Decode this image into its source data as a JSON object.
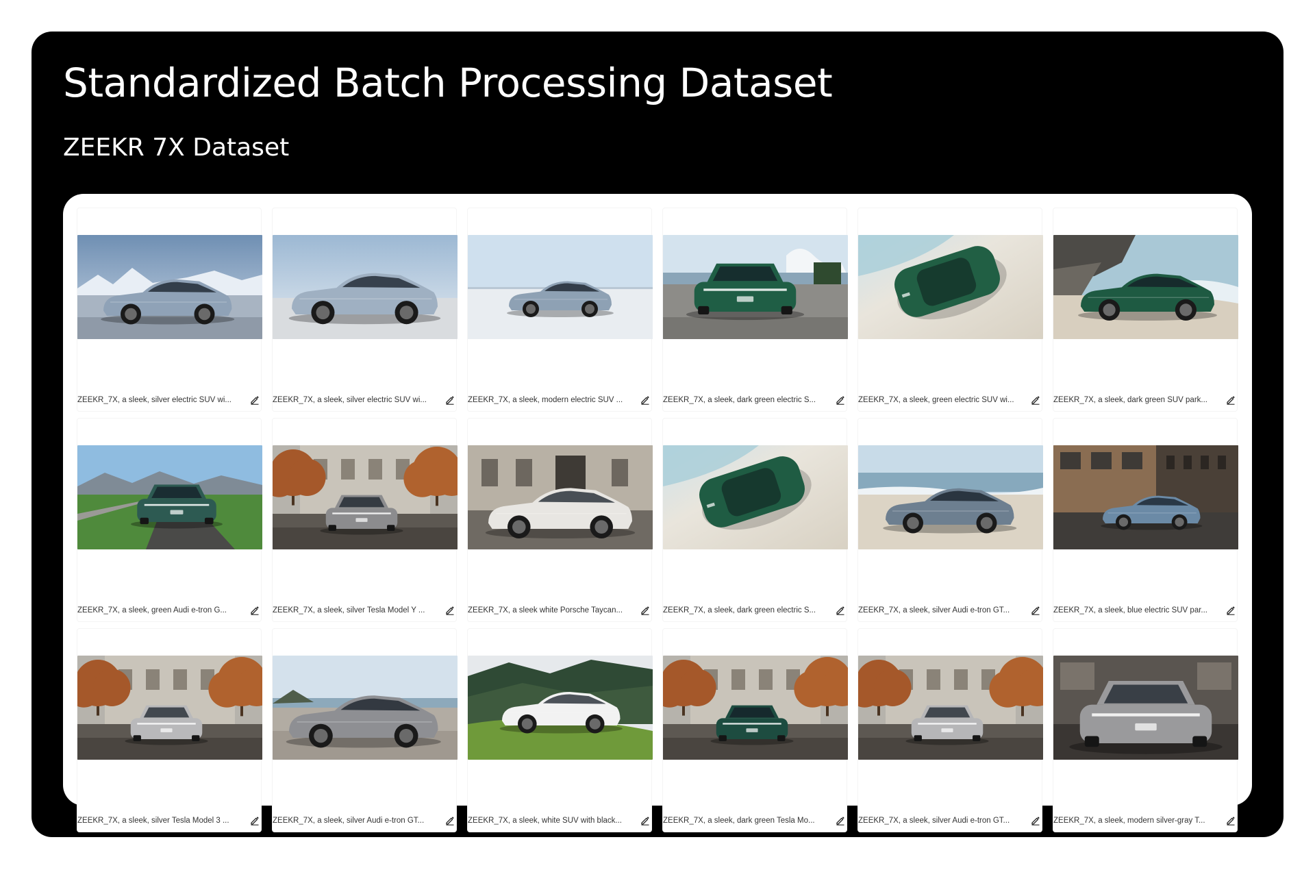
{
  "header": {
    "title": "Standardized Batch Processing Dataset",
    "subtitle": "ZEEKR 7X Dataset"
  },
  "items": [
    {
      "caption": "ZEEKR_7X, a sleek, silver electric SUV wi...",
      "scene": "snow-mountain",
      "car_color": "#8fa2b7"
    },
    {
      "caption": "ZEEKR_7X, a sleek, silver electric SUV wi...",
      "scene": "studio-sky",
      "car_color": "#9fb0c2"
    },
    {
      "caption": "ZEEKR_7X, a sleek, modern electric SUV ...",
      "scene": "salt-flat",
      "car_color": "#8ea1b4"
    },
    {
      "caption": "ZEEKR_7X, a sleek, dark green electric S...",
      "scene": "coast-road",
      "car_color": "#1f5e45"
    },
    {
      "caption": "ZEEKR_7X, a sleek, green electric SUV wi...",
      "scene": "beach-top",
      "car_color": "#215f44"
    },
    {
      "caption": "ZEEKR_7X, a sleek, dark green SUV park...",
      "scene": "rocky-beach",
      "car_color": "#1e5a42"
    },
    {
      "caption": "ZEEKR_7X, a sleek, green Audi e-tron G...",
      "scene": "green-road",
      "car_color": "#2d5a52"
    },
    {
      "caption": "ZEEKR_7X, a sleek, silver Tesla Model Y ...",
      "scene": "autumn-street",
      "car_color": "#8c8c8e"
    },
    {
      "caption": "ZEEKR_7X, a sleek white Porsche Taycan...",
      "scene": "stone-building",
      "car_color": "#e8e6e2"
    },
    {
      "caption": "ZEEKR_7X, a sleek, dark green electric S...",
      "scene": "beach-top",
      "car_color": "#1f5c43"
    },
    {
      "caption": "ZEEKR_7X, a sleek, silver Audi e-tron GT...",
      "scene": "beach-side",
      "car_color": "#6d7f90"
    },
    {
      "caption": "ZEEKR_7X, a sleek, blue electric SUV par...",
      "scene": "city-building",
      "car_color": "#6b8aa6"
    },
    {
      "caption": "ZEEKR_7X, a sleek, silver Tesla Model 3 ...",
      "scene": "autumn-street",
      "car_color": "#b9b9bb"
    },
    {
      "caption": "ZEEKR_7X, a sleek, silver Audi e-tron GT...",
      "scene": "gravel-lake",
      "car_color": "#8e8f93"
    },
    {
      "caption": "ZEEKR_7X, a sleek, white SUV with black...",
      "scene": "forest-hill",
      "car_color": "#f2f2f2"
    },
    {
      "caption": "ZEEKR_7X, a sleek, dark green Tesla Mo...",
      "scene": "autumn-street",
      "car_color": "#1d4c40"
    },
    {
      "caption": "ZEEKR_7X, a sleek, silver Audi e-tron GT...",
      "scene": "autumn-street",
      "car_color": "#b6b6b8"
    },
    {
      "caption": "ZEEKR_7X, a sleek, modern silver-gray T...",
      "scene": "garage-front",
      "car_color": "#9a9a9c"
    }
  ]
}
